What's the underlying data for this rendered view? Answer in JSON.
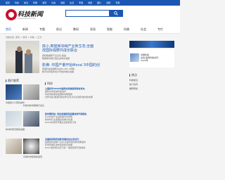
{
  "topnav": [
    "首页",
    "科技",
    "前沿",
    "智能",
    "发现",
    "社会",
    "健康",
    "生活",
    "军事",
    "视频",
    "图片",
    "话题",
    "专题"
  ],
  "header": {
    "logo_text": "科技新闻",
    "logo_url": "www.kxtech.com"
  },
  "search": {
    "placeholder": ""
  },
  "subnav": [
    "首页",
    "新闻",
    "专题",
    "前沿",
    "数码",
    "发现",
    "智能",
    "科普",
    "社会",
    "专栏"
  ],
  "breadcrumb": "当前位置: 首页 > 新闻 > 科技 > 正文",
  "featured": [
    {
      "title_line1": "陈小,数据库领域产业新生态,全面",
      "title_line2": "改国际视野共成长联合",
      "desc_line1": "国际数据库产业论坛,提速",
      "desc_line2": "数据库领域打造生态体系发展"
    },
    {
      "title": "影佛: 中国产量开始Moral 3中国的创",
      "desc_line1": "我国科技发展新生态ELAB1.1学期,",
      "desc_line2": "数字化转型的动力开始智能化发展"
    }
  ],
  "side": {
    "heading": "图片推荐",
    "items": [
      {
        "caption": "中国量子计算机操作"
      },
      {
        "caption": "科技创新成果展示会议"
      },
      {
        "caption": "新材料研究取得进展"
      },
      {
        "caption": "月球科学探测新发现"
      }
    ]
  },
  "main": {
    "heading": "科技",
    "articles": [
      {
        "title": "大量科学2020中国科技发展趋势报告发布,",
        "desc1": "国际合作促进科技进步,",
        "desc2": "科技创新驱动发展新动能报告",
        "desc3": "合作共赢,推进科技合作交流,共享全球科技创新成果"
      },
      {
        "title": "新时期科技: 科技发展取得显著成效年度报告",
        "desc1": "长沙科技产业园区数字化转型,",
        "desc2": "新材料行业发展迎来重大机遇,",
        "desc3": "NASA科学家开展太空探索新计划"
      },
      {
        "title": "全国科研院所创新发展论坛在京召开,",
        "desc1": "由国家科技部门主办,年度科技创新成果发布",
        "desc2": "科学家团队发布最新研究成果,",
        "desc3": "NASA发布新太空计划,一起来探索宇宙奥秘"
      }
    ]
  },
  "right": {
    "box_line1": "中国科技",
    "box_line2": "在线,提供科技资讯,",
    "box_line3": "2020年",
    "list_heading": "热点",
    "links": [
      "科技前沿",
      "热门资讯",
      "推荐阅读"
    ]
  },
  "colors": {
    "brand": "#1a57b3",
    "background": "#f4f4f4"
  }
}
